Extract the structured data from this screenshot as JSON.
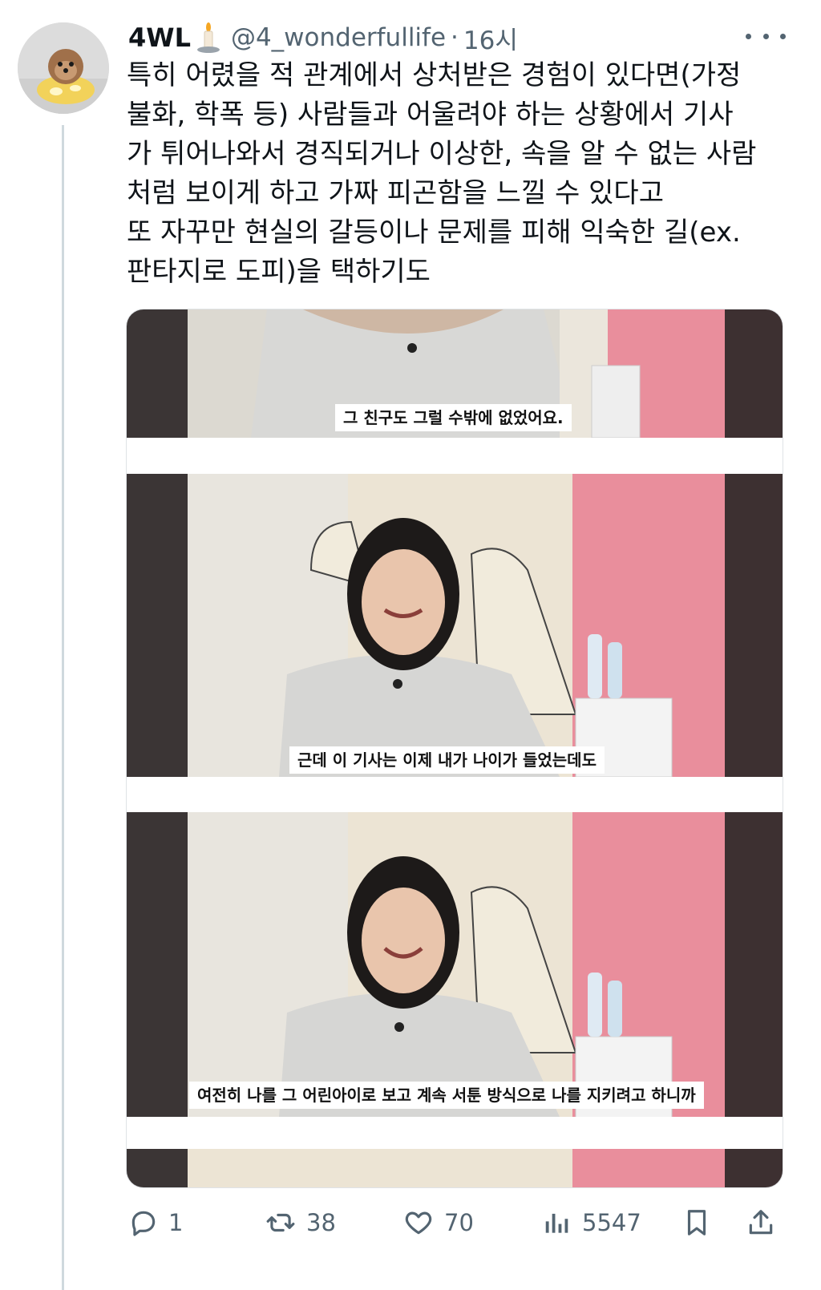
{
  "author": {
    "name": "4WL",
    "handle": "@4_wonderfullife",
    "separator": "·",
    "time": "16시"
  },
  "tweet": {
    "lines": [
      "특히 어렸을 적 관계에서 상처받은 경험이 있다면(가정",
      "불화, 학폭 등) 사람들과 어울려야 하는 상황에서 기사",
      "가 튀어나와서 경직되거나 이상한, 속을 알 수 없는 사람",
      "처럼 보이게 하고 가짜 피곤함을 느낄 수 있다고",
      "또 자꾸만 현실의 갈등이나 문제를 피해 익숙한 길(ex.",
      "판타지로 도피)을 택하기도"
    ]
  },
  "media": {
    "captions": [
      "그 친구도 그럴 수밖에 없었어요.",
      "근데 이 기사는 이제 내가 나이가 들었는데도",
      "여전히 나를 그 어린아이로 보고 계속 서툰 방식으로 나를 지키려고 하니까"
    ]
  },
  "actions": {
    "replies": "1",
    "retweets": "38",
    "likes": "70",
    "views": "5547"
  },
  "icons": [
    "reply-icon",
    "retweet-icon",
    "like-icon",
    "views-icon",
    "bookmark-icon",
    "share-icon",
    "more-icon",
    "candle-icon"
  ],
  "colors": {
    "text": "#0f1419",
    "secondary": "#536471",
    "thread_line": "#cfd9de"
  }
}
